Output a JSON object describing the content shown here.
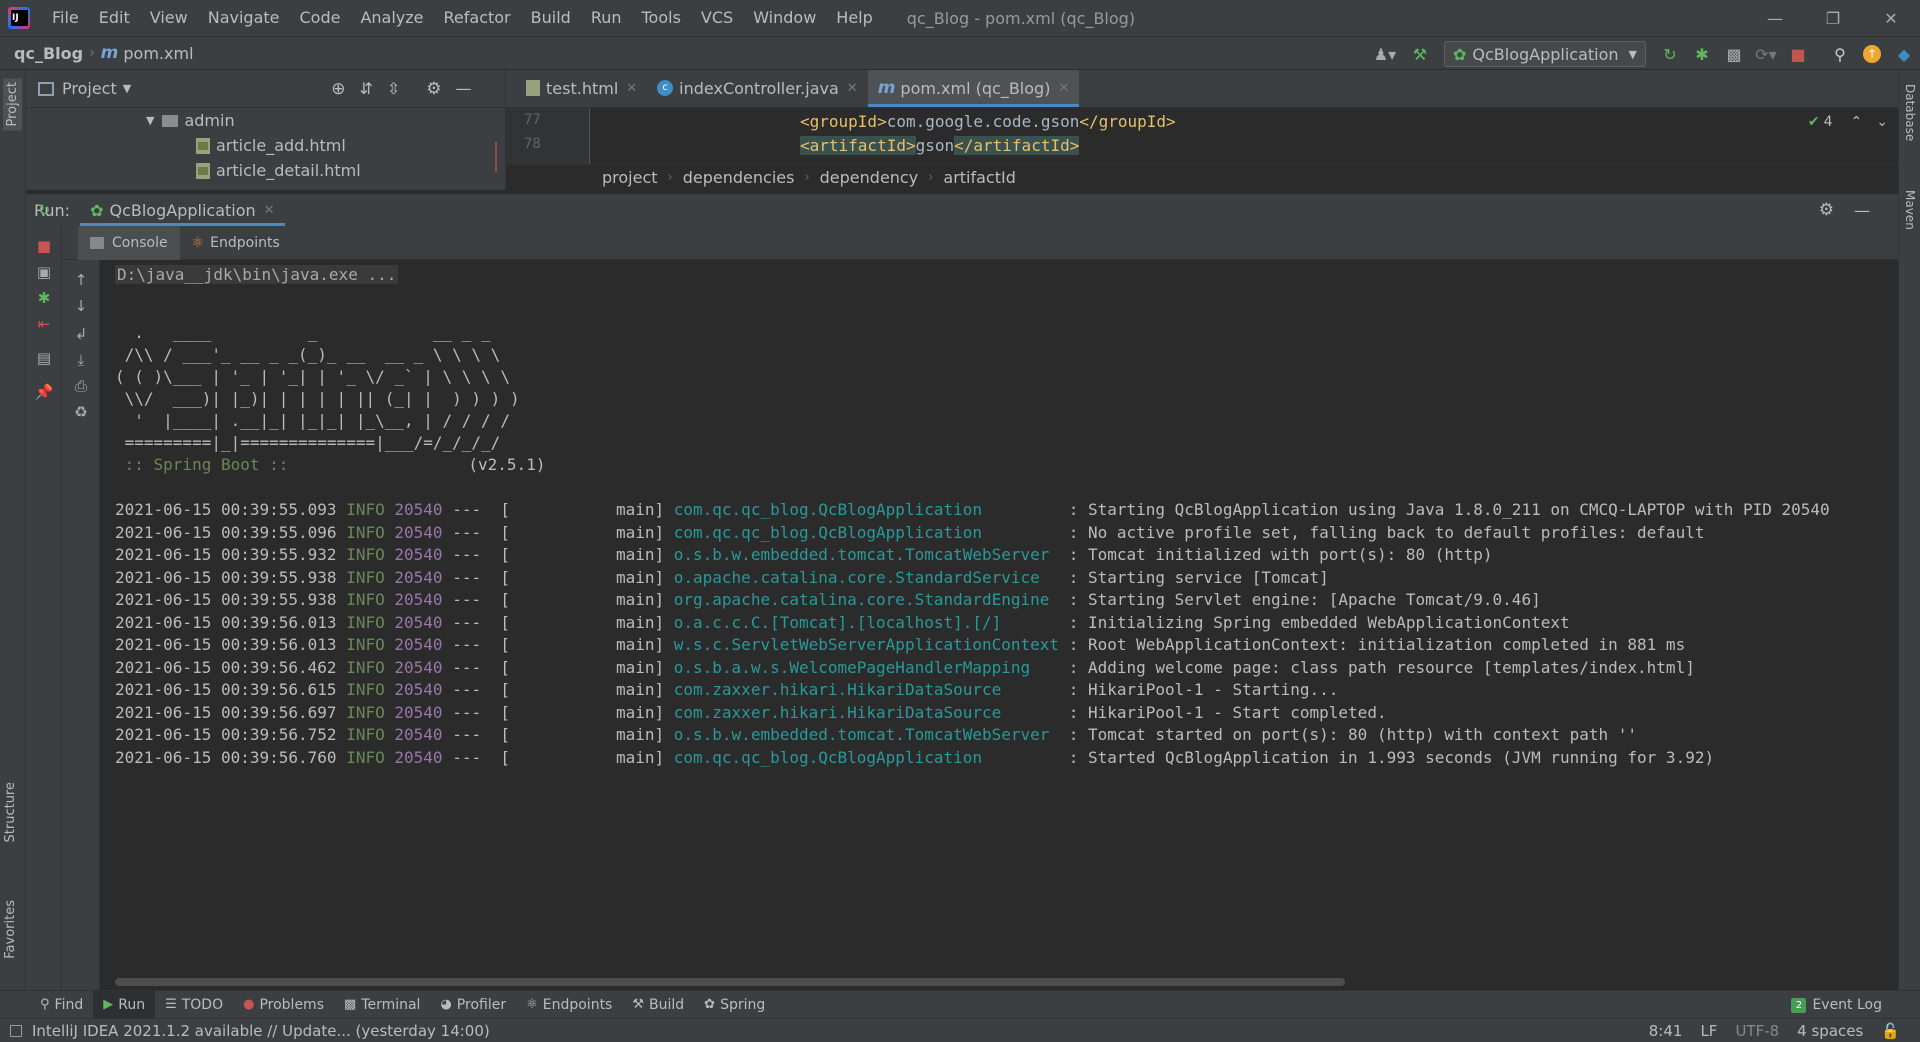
{
  "menu": [
    "File",
    "Edit",
    "View",
    "Navigate",
    "Code",
    "Analyze",
    "Refactor",
    "Build",
    "Run",
    "Tools",
    "VCS",
    "Window",
    "Help"
  ],
  "window_title": "qc_Blog - pom.xml (qc_Blog)",
  "nav": {
    "project": "qc_Blog",
    "file": "pom.xml"
  },
  "run_config": "QcBlogApplication",
  "project_panel": {
    "title": "Project",
    "tree": [
      {
        "name": "admin",
        "type": "folder"
      },
      {
        "name": "article_add.html",
        "type": "html"
      },
      {
        "name": "article_detail.html",
        "type": "html"
      }
    ]
  },
  "editor": {
    "tabs": [
      {
        "label": "test.html",
        "icon": "html-file-icon"
      },
      {
        "label": "indexController.java",
        "icon": "class-icon"
      },
      {
        "label": "pom.xml (qc_Blog)",
        "icon": "maven-icon"
      }
    ],
    "lines": [
      {
        "no": "77",
        "open": "<groupId>",
        "text": "com.google.code.gson",
        "close": "</groupId>"
      },
      {
        "no": "78",
        "open": "<artifactId>",
        "text": "gson",
        "close": "</artifactId>"
      }
    ],
    "inspection_count": "4",
    "breadcrumb": [
      "project",
      "dependencies",
      "dependency",
      "artifactId"
    ]
  },
  "run_panel": {
    "label": "Run:",
    "tab": "QcBlogApplication",
    "subtabs": [
      "Console",
      "Endpoints"
    ]
  },
  "console": {
    "command": "D:\\java__jdk\\bin\\java.exe ...",
    "banner": [
      "  .   ____          _            __ _ _",
      " /\\\\ / ___'_ __ _ _(_)_ __  __ _ \\ \\ \\ \\",
      "( ( )\\___ | '_ | '_| | '_ \\/ _` | \\ \\ \\ \\",
      " \\\\/  ___)| |_)| | | | | || (_| |  ) ) ) )",
      "  '  |____| .__|_| |_|_| |_\\__, | / / / /",
      " =========|_|==============|___/=/_/_/_/"
    ],
    "spring_label": " :: Spring Boot ::",
    "spring_version": "(v2.5.1)",
    "logs": [
      {
        "ts": "2021-06-15 00:39:55.093",
        "level": "INFO",
        "pid": "20540",
        "thread": "---  [           main]",
        "logger": "com.qc.qc_blog.QcBlogApplication        ",
        "msg": " : Starting QcBlogApplication using Java 1.8.0_211 on CMCQ-LAPTOP with PID 20540"
      },
      {
        "ts": "2021-06-15 00:39:55.096",
        "level": "INFO",
        "pid": "20540",
        "thread": "---  [           main]",
        "logger": "com.qc.qc_blog.QcBlogApplication        ",
        "msg": " : No active profile set, falling back to default profiles: default"
      },
      {
        "ts": "2021-06-15 00:39:55.932",
        "level": "INFO",
        "pid": "20540",
        "thread": "---  [           main]",
        "logger": "o.s.b.w.embedded.tomcat.TomcatWebServer ",
        "msg": " : Tomcat initialized with port(s): 80 (http)"
      },
      {
        "ts": "2021-06-15 00:39:55.938",
        "level": "INFO",
        "pid": "20540",
        "thread": "---  [           main]",
        "logger": "o.apache.catalina.core.StandardService  ",
        "msg": " : Starting service [Tomcat]"
      },
      {
        "ts": "2021-06-15 00:39:55.938",
        "level": "INFO",
        "pid": "20540",
        "thread": "---  [           main]",
        "logger": "org.apache.catalina.core.StandardEngine ",
        "msg": " : Starting Servlet engine: [Apache Tomcat/9.0.46]"
      },
      {
        "ts": "2021-06-15 00:39:56.013",
        "level": "INFO",
        "pid": "20540",
        "thread": "---  [           main]",
        "logger": "o.a.c.c.C.[Tomcat].[localhost].[/]      ",
        "msg": " : Initializing Spring embedded WebApplicationContext"
      },
      {
        "ts": "2021-06-15 00:39:56.013",
        "level": "INFO",
        "pid": "20540",
        "thread": "---  [           main]",
        "logger": "w.s.c.ServletWebServerApplicationContext",
        "msg": " : Root WebApplicationContext: initialization completed in 881 ms"
      },
      {
        "ts": "2021-06-15 00:39:56.462",
        "level": "INFO",
        "pid": "20540",
        "thread": "---  [           main]",
        "logger": "o.s.b.a.w.s.WelcomePageHandlerMapping   ",
        "msg": " : Adding welcome page: class path resource [templates/index.html]"
      },
      {
        "ts": "2021-06-15 00:39:56.615",
        "level": "INFO",
        "pid": "20540",
        "thread": "---  [           main]",
        "logger": "com.zaxxer.hikari.HikariDataSource      ",
        "msg": " : HikariPool-1 - Starting..."
      },
      {
        "ts": "2021-06-15 00:39:56.697",
        "level": "INFO",
        "pid": "20540",
        "thread": "---  [           main]",
        "logger": "com.zaxxer.hikari.HikariDataSource      ",
        "msg": " : HikariPool-1 - Start completed."
      },
      {
        "ts": "2021-06-15 00:39:56.752",
        "level": "INFO",
        "pid": "20540",
        "thread": "---  [           main]",
        "logger": "o.s.b.w.embedded.tomcat.TomcatWebServer ",
        "msg": " : Tomcat started on port(s): 80 (http) with context path ''"
      },
      {
        "ts": "2021-06-15 00:39:56.760",
        "level": "INFO",
        "pid": "20540",
        "thread": "---  [           main]",
        "logger": "com.qc.qc_blog.QcBlogApplication        ",
        "msg": " : Started QcBlogApplication in 1.993 seconds (JVM running for 3.92)"
      }
    ]
  },
  "bottom_tools": [
    {
      "label": "Find",
      "icon": "search-icon"
    },
    {
      "label": "Run",
      "icon": "play-icon"
    },
    {
      "label": "TODO",
      "icon": "list-icon"
    },
    {
      "label": "Problems",
      "icon": "error-icon"
    },
    {
      "label": "Terminal",
      "icon": "terminal-icon"
    },
    {
      "label": "Profiler",
      "icon": "profiler-icon"
    },
    {
      "label": "Endpoints",
      "icon": "endpoints-icon"
    },
    {
      "label": "Build",
      "icon": "hammer-icon"
    },
    {
      "label": "Spring",
      "icon": "spring-icon"
    }
  ],
  "event_log": {
    "count": "2",
    "label": "Event Log"
  },
  "left_strip": [
    "Project",
    "Structure",
    "Favorites"
  ],
  "right_strip": [
    "Database",
    "Maven"
  ],
  "status": {
    "message": "IntelliJ IDEA 2021.1.2 available // Update... (yesterday 14:00)",
    "position": "8:41",
    "line_sep": "LF",
    "encoding": "UTF-8",
    "indent": "4 spaces"
  },
  "colors": {
    "accent": "#4a88c7",
    "info": "#6a8759",
    "logger": "#299999",
    "tag": "#e8bf6a"
  }
}
